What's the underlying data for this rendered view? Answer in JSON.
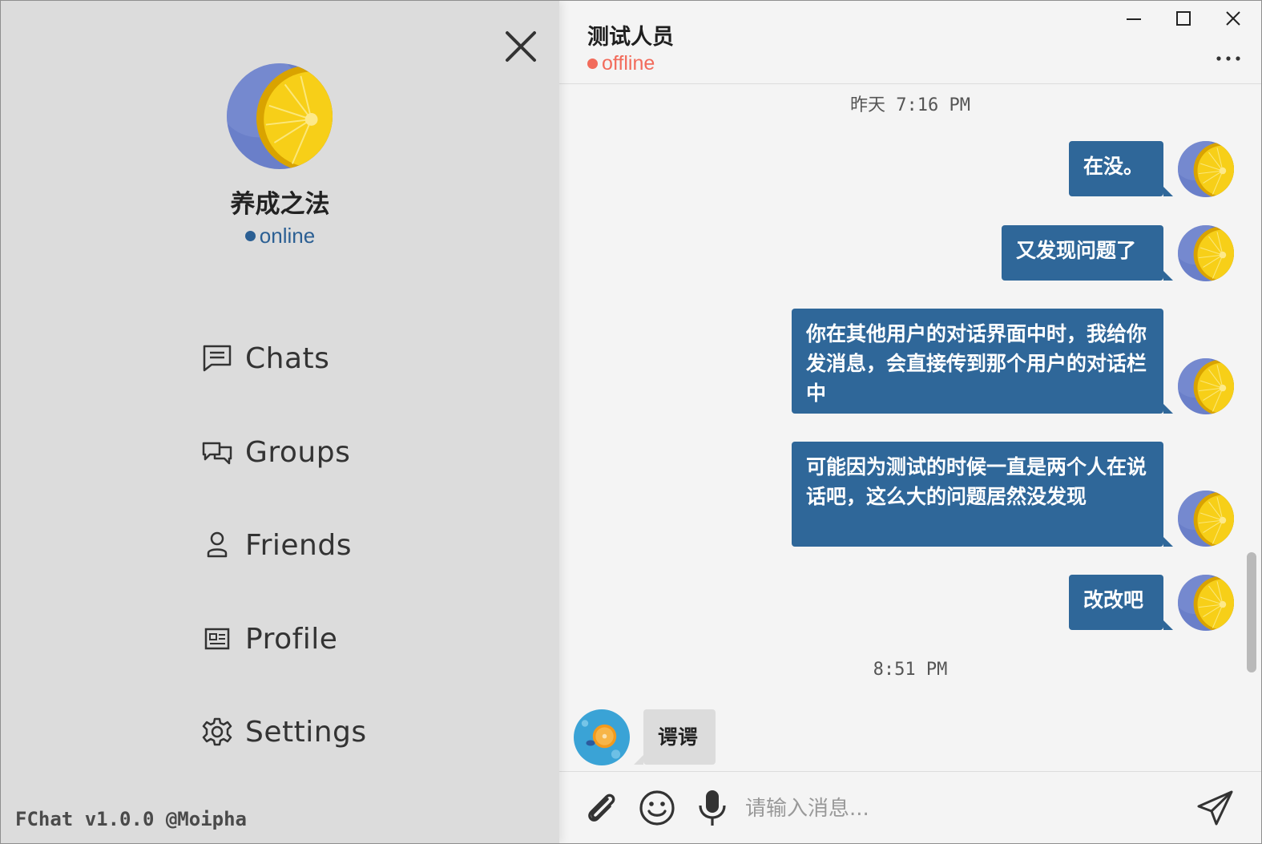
{
  "drawer": {
    "user_name": "养成之法",
    "user_status": "online",
    "nav": [
      {
        "label": "Chats",
        "icon": "chat-icon"
      },
      {
        "label": "Groups",
        "icon": "groups-icon"
      },
      {
        "label": "Friends",
        "icon": "friend-icon"
      },
      {
        "label": "Profile",
        "icon": "profile-icon"
      },
      {
        "label": "Settings",
        "icon": "gear-icon"
      }
    ],
    "version": "FChat v1.0.0 @Moipha"
  },
  "chat": {
    "contact_name": "测试人员",
    "contact_status": "offline",
    "timestamps": [
      "昨天 7:16 PM",
      "8:51 PM"
    ],
    "messages": [
      {
        "from": "me",
        "text": "在没。"
      },
      {
        "from": "me",
        "text": "又发现问题了"
      },
      {
        "from": "me",
        "text": "你在其他用户的对话界面中时，我给你发消息，会直接传到那个用户的对话栏中"
      },
      {
        "from": "me",
        "text": "可能因为测试的时候一直是两个人在说话吧，这么大的问题居然没发现"
      },
      {
        "from": "me",
        "text": "改改吧"
      },
      {
        "from": "contact",
        "text": "谔谔"
      }
    ],
    "input_placeholder": "请输入消息..."
  },
  "colors": {
    "accent": "#2f6799",
    "online": "#2b5f93",
    "offline": "#f26b5b",
    "drawer_bg": "#dcdcdc",
    "chat_bg": "#f4f4f4"
  }
}
